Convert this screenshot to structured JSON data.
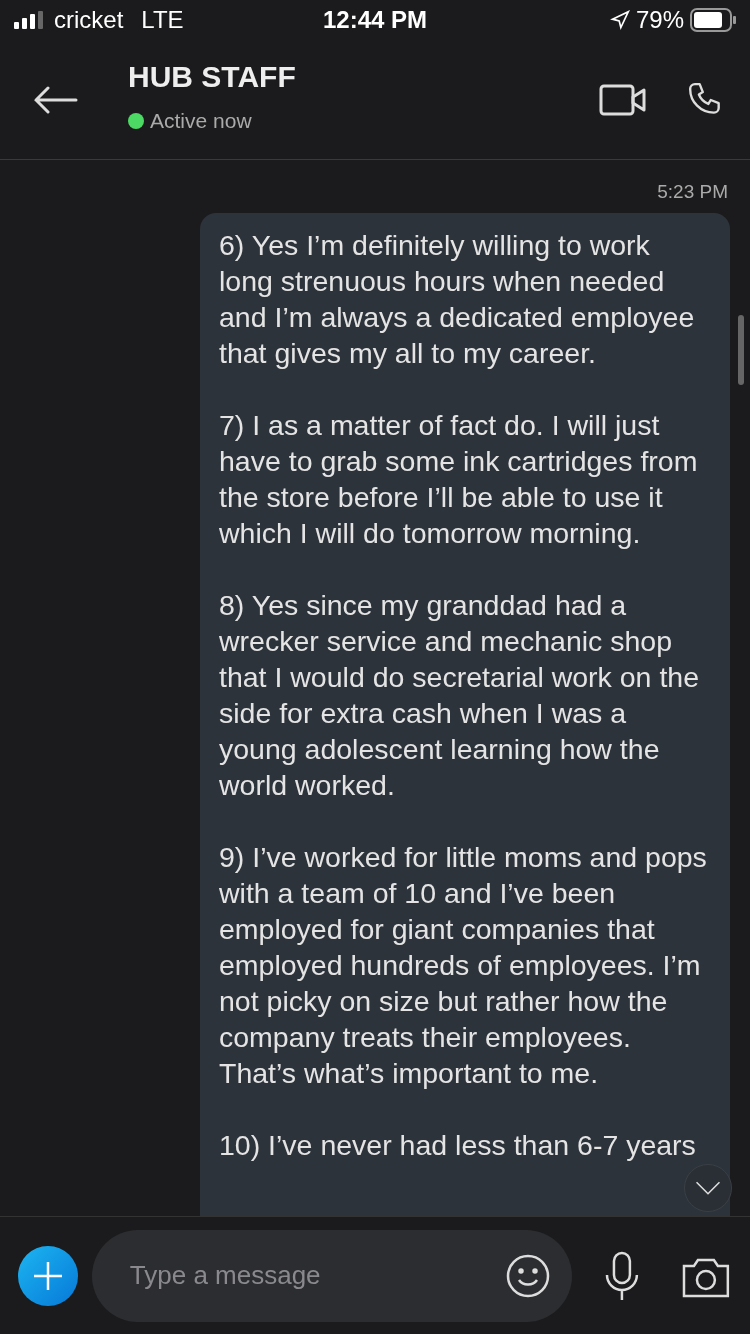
{
  "status_bar": {
    "carrier": "cricket",
    "network": "LTE",
    "time": "12:44 PM",
    "battery": "79%"
  },
  "header": {
    "title": "HUB STAFF",
    "status": "Active now",
    "online": true
  },
  "messages": [
    {
      "time": "5:23 PM",
      "paragraphs": [
        "6) Yes I’m definitely willing to work long strenuous hours when needed and I’m always a dedicated employee that gives my all to my career.",
        "7) I as a matter of fact do. I will just have to grab some ink cartridges from the store before I’ll be able to use it which I will do tomorrow morning.",
        "8) Yes since my granddad had a wrecker service and mechanic shop that I would do secretarial work on the side for extra cash when I was a young adolescent learning how the world worked.",
        "9) I’ve worked for little moms and pops with a team of 10 and I’ve been employed for giant companies that employed hundreds of employees. I’m not picky on size but rather how the company treats their employees. That’s what’s important to me.",
        "10) I’ve never had less than 6-7 years"
      ]
    }
  ],
  "composer": {
    "placeholder": "Type a message"
  }
}
